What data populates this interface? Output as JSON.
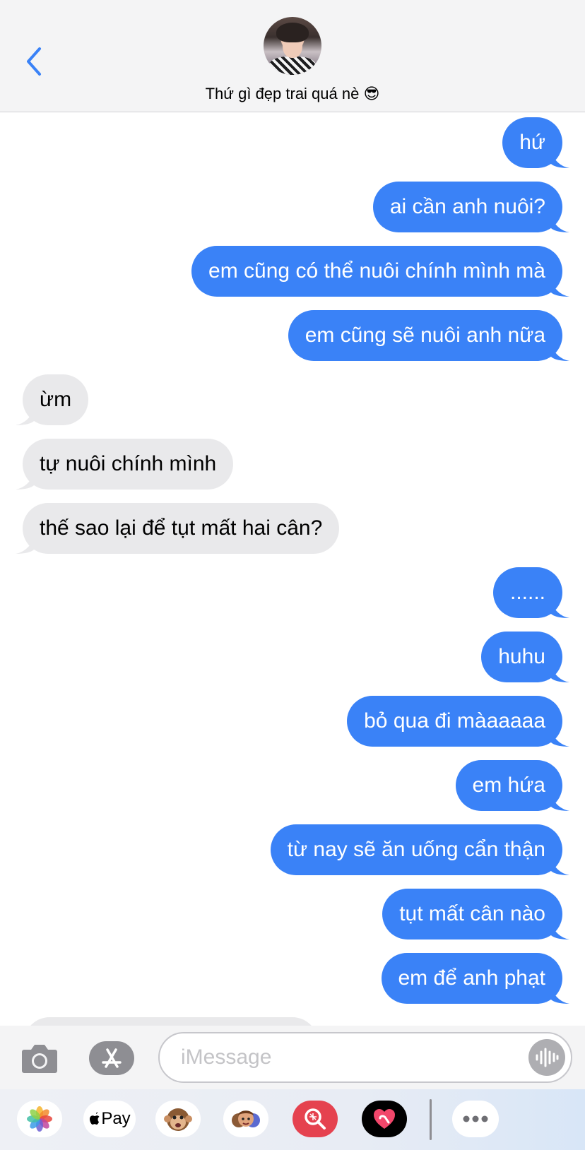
{
  "header": {
    "contact_name": "Thứ gì đẹp trai quá nè 😎",
    "back_icon": "chevron-left-icon",
    "accent_color": "#3a82f7"
  },
  "messages": [
    {
      "side": "sent",
      "text": "hứ"
    },
    {
      "side": "sent",
      "text": "ai cần anh nuôi?"
    },
    {
      "side": "sent",
      "text": "em cũng có thể nuôi chính mình mà"
    },
    {
      "side": "sent",
      "text": "em cũng sẽ nuôi anh nữa"
    },
    {
      "side": "received",
      "text": "ừm"
    },
    {
      "side": "received",
      "text": "tự nuôi chính mình"
    },
    {
      "side": "received",
      "text": "thế sao lại để tụt mất hai cân?"
    },
    {
      "side": "sent",
      "text": "......"
    },
    {
      "side": "sent",
      "text": "huhu"
    },
    {
      "side": "sent",
      "text": "bỏ qua đi màaaaaa"
    },
    {
      "side": "sent",
      "text": "em hứa"
    },
    {
      "side": "sent",
      "text": "từ nay sẽ ăn uống cẩn thận"
    },
    {
      "side": "sent",
      "text": "tụt mất cân nào"
    },
    {
      "side": "sent",
      "text": "em để anh phạt"
    }
  ],
  "input": {
    "placeholder": "iMessage",
    "camera_icon": "camera-icon",
    "appstore_icon": "app-store-icon",
    "audio_icon": "audio-waveform-icon"
  },
  "app_strip": {
    "apple_pay_label": "Pay",
    "apps": [
      "photos-icon",
      "apple-pay-icon",
      "monkey-memoji-icon",
      "memoji-stickers-icon",
      "image-search-icon",
      "digital-touch-icon",
      "more-icon"
    ]
  }
}
